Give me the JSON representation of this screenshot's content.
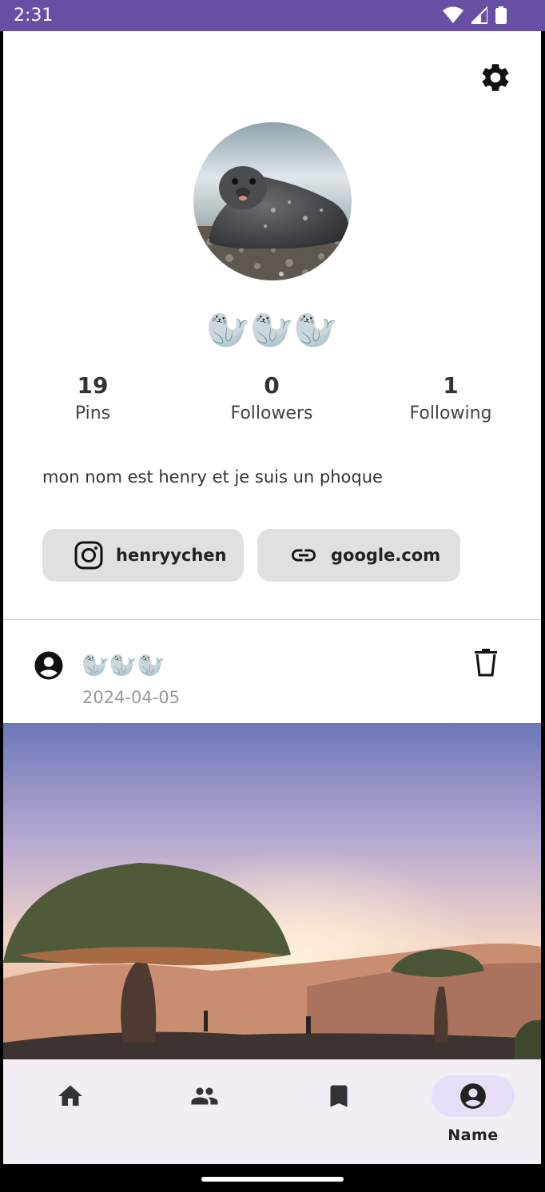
{
  "status_bar": {
    "time": "2:31",
    "icons": [
      "wifi-icon",
      "signal-icon",
      "battery-icon"
    ]
  },
  "profile": {
    "display_name": "🦭🦭🦭",
    "bio": "mon nom est henry et je suis un phoque",
    "stats": [
      {
        "count": "19",
        "label": "Pins"
      },
      {
        "count": "0",
        "label": "Followers"
      },
      {
        "count": "1",
        "label": "Following"
      }
    ],
    "links": [
      {
        "icon": "instagram-icon",
        "label": "henryychen"
      },
      {
        "icon": "link-icon",
        "label": "google.com"
      }
    ]
  },
  "post": {
    "author": "🦭🦭🦭",
    "date": "2024-04-05"
  },
  "bottom_nav": {
    "items": [
      {
        "icon": "home-icon",
        "label": ""
      },
      {
        "icon": "people-icon",
        "label": ""
      },
      {
        "icon": "bookmark-icon",
        "label": ""
      },
      {
        "icon": "account-icon",
        "label": "Name",
        "active": true
      }
    ]
  },
  "colors": {
    "status_bar": "#6750a4",
    "nav_background": "#f3edf6",
    "nav_active": "#e8def8",
    "chip": "#e0e0e0"
  }
}
